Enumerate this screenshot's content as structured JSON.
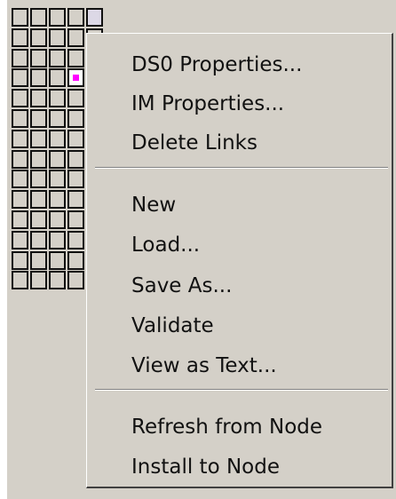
{
  "colors": {
    "menu_background": "#d4d0c8",
    "menu_text": "#111111",
    "selection_marker": "#ff00ff",
    "grid_border": "#111111"
  },
  "context_menu": {
    "items": [
      {
        "label": "DS0 Properties..."
      },
      {
        "label": "IM Properties..."
      },
      {
        "label": "Delete Links"
      },
      {
        "label": "New"
      },
      {
        "label": "Load..."
      },
      {
        "label": "Save As..."
      },
      {
        "label": "Validate"
      },
      {
        "label": "View as Text..."
      },
      {
        "label": "Refresh from Node"
      },
      {
        "label": "Install to Node"
      }
    ]
  }
}
